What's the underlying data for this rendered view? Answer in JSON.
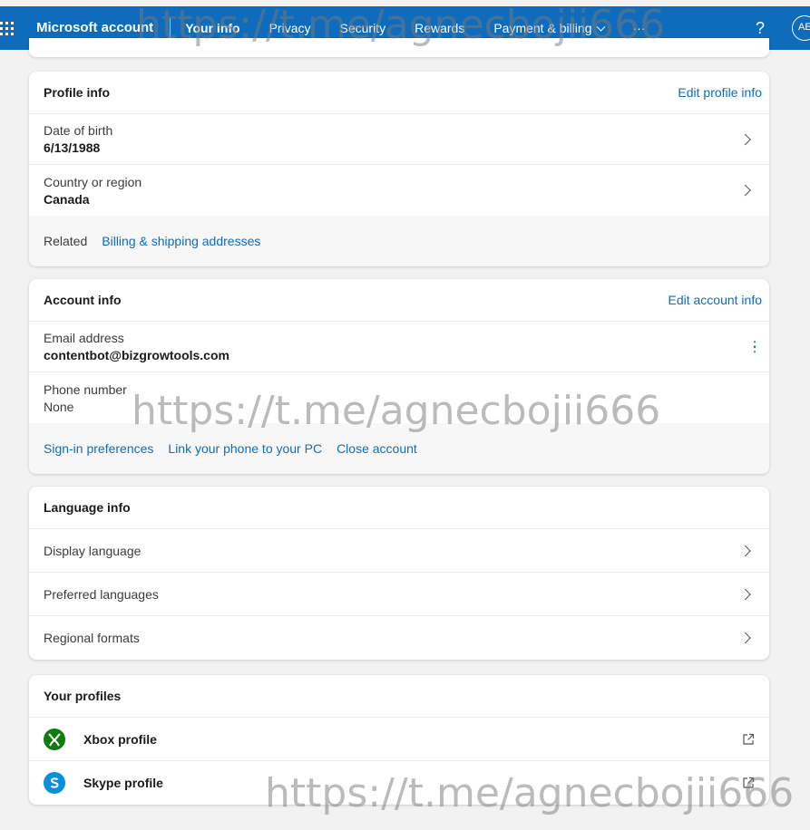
{
  "topbar": {
    "brand": "Microsoft account",
    "nav": [
      {
        "label": "Your info",
        "active": true
      },
      {
        "label": "Privacy",
        "active": false
      },
      {
        "label": "Security",
        "active": false
      },
      {
        "label": "Rewards",
        "active": false
      },
      {
        "label": "Payment & billing",
        "active": false
      }
    ],
    "more": "···",
    "help": "?",
    "avatar_initials": "AE"
  },
  "profile_info": {
    "title": "Profile info",
    "edit_link": "Edit profile info",
    "rows": [
      {
        "label": "Date of birth",
        "value": "6/13/1988"
      },
      {
        "label": "Country or region",
        "value": "Canada"
      }
    ],
    "related_label": "Related",
    "related_link": "Billing & shipping addresses"
  },
  "account_info": {
    "title": "Account info",
    "edit_link": "Edit account info",
    "rows": [
      {
        "label": "Email address",
        "value": "contentbot@bizgrowtools.com"
      },
      {
        "label": "Phone number",
        "value": "None"
      }
    ],
    "links": [
      "Sign-in preferences",
      "Link your phone to your PC",
      "Close account"
    ]
  },
  "language_info": {
    "title": "Language info",
    "rows": [
      "Display language",
      "Preferred languages",
      "Regional formats"
    ]
  },
  "your_profiles": {
    "title": "Your profiles",
    "rows": [
      {
        "name": "Xbox profile",
        "icon": "xbox-icon"
      },
      {
        "name": "Skype profile",
        "icon": "skype-icon"
      }
    ]
  },
  "watermarks": [
    "https://t.me/agnecbojii666",
    "https://t.me/agnecbojii666",
    "https://t.me/agnecbojii666"
  ],
  "colors": {
    "accent": "#0f6cbd",
    "xbox": "#107c10",
    "skype": "#0a8fdc"
  }
}
